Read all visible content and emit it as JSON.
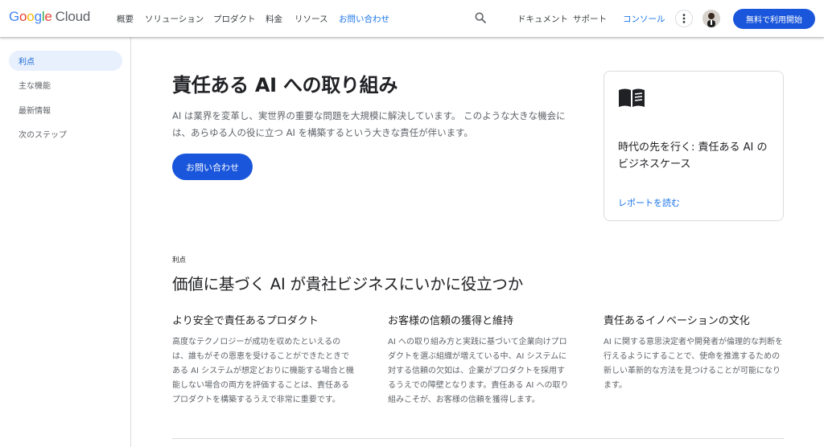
{
  "header": {
    "logo_letters": [
      "G",
      "o",
      "o",
      "g",
      "l",
      "e"
    ],
    "logo_cloud": "Cloud",
    "nav": [
      "概要",
      "ソリューション",
      "プロダクト",
      "料金",
      "リソース",
      "お問い合わせ"
    ],
    "docs": "ドキュメント",
    "support": "サポート",
    "console": "コンソール",
    "cta": "無料で利用開始",
    "colors": {
      "accent": "#1a73e8",
      "button": "#1a56db"
    }
  },
  "sidebar": {
    "items": [
      {
        "label": "利点"
      },
      {
        "label": "主な機能"
      },
      {
        "label": "最新情報"
      },
      {
        "label": "次のステップ"
      }
    ]
  },
  "hero": {
    "title": "責任ある AI への取り組み",
    "description": "AI は業界を変革し、実世界の重要な問題を大規模に解決しています。 このような大きな機会には、あらゆる人の役に立つ AI を構築するという大きな責任が伴います。",
    "button": "お問い合わせ"
  },
  "card": {
    "icon": "book-icon",
    "title": "時代の先を行く: 責任ある AI のビジネスケース",
    "link": "レポートを読む"
  },
  "benefits": {
    "eyebrow": "利点",
    "title": "価値に基づく AI が貴社ビジネスにいかに役立つか",
    "columns": [
      {
        "title": "より安全で責任あるプロダクト",
        "body": "高度なテクノロジーが成功を収めたといえるのは、誰もがその恩恵を受けることができたときである AI システムが想定どおりに機能する場合と機能しない場合の両方を評価することは、責任あるプロダクトを構築するうえで非常に重要です。"
      },
      {
        "title": "お客様の信頼の獲得と維持",
        "body": "AI への取り組み方と実践に基づいて企業向けプロダクトを選ぶ組織が増えている中、AI システムに対する信頼の欠如は、企業がプロダクトを採用するうえでの障壁となります。責任ある AI への取り組みこそが、お客様の信頼を獲得します。"
      },
      {
        "title": "責任あるイノベーションの文化",
        "body": "AI に関する意思決定者や開発者が倫理的な判断を行えるようにすることで、使命を推進するための新しい革新的な方法を見つけることが可能になります。"
      }
    ]
  }
}
